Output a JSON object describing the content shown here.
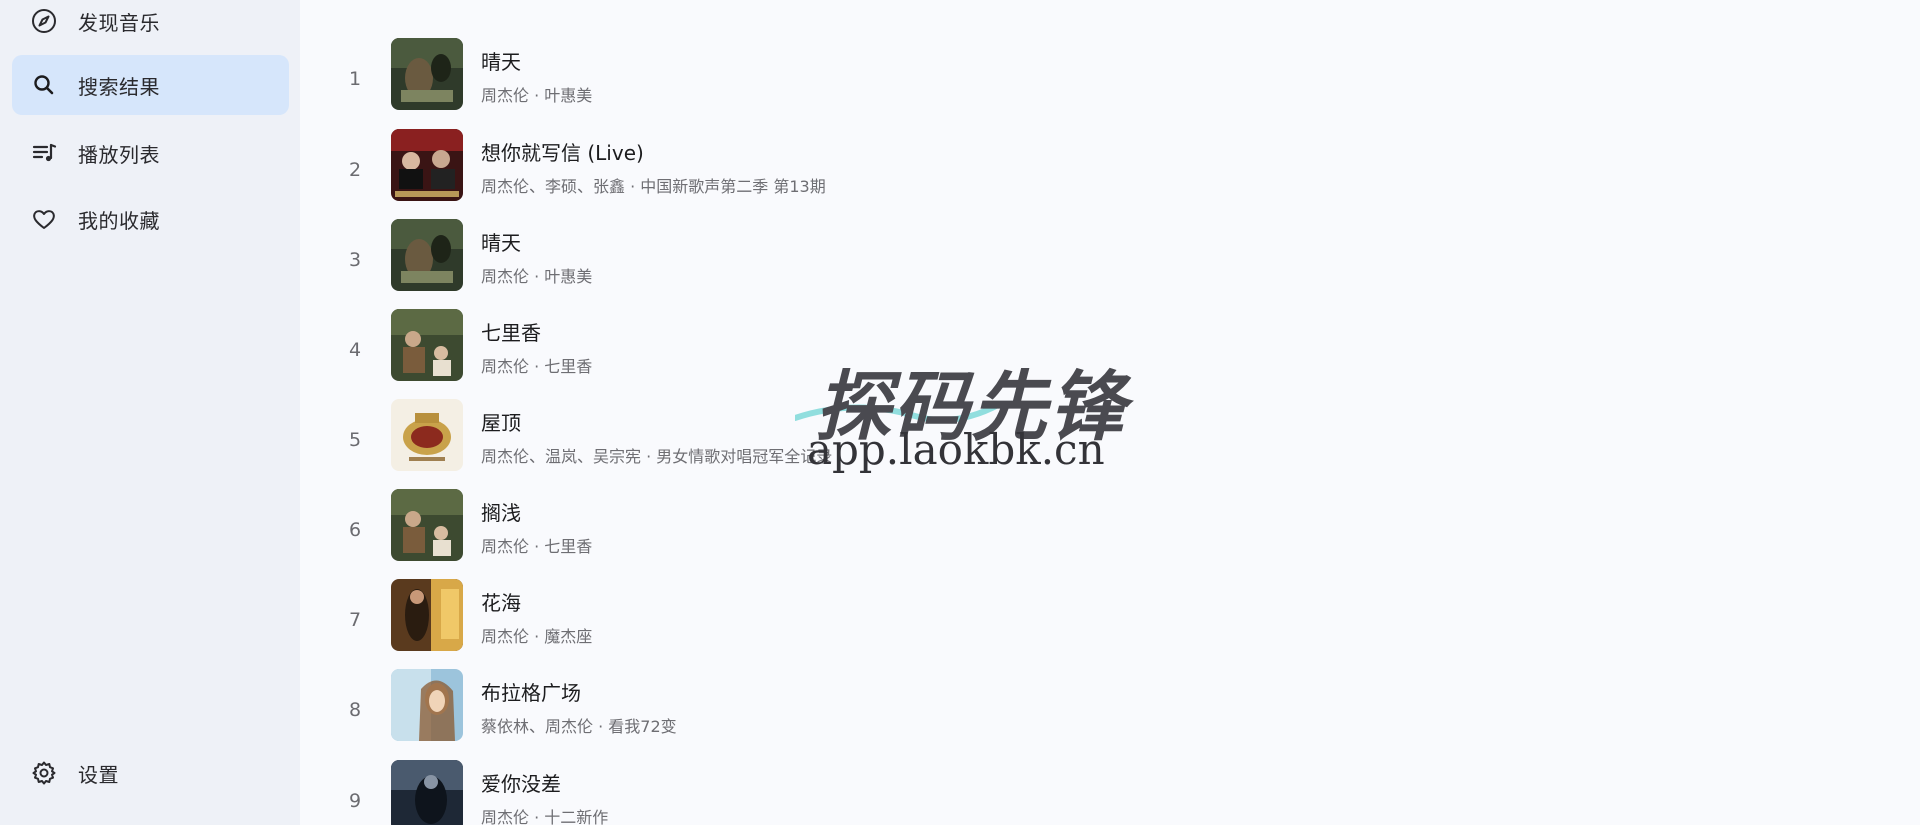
{
  "sidebar": {
    "items": [
      {
        "label": "发现音乐",
        "icon": "compass-icon",
        "active": false
      },
      {
        "label": "搜索结果",
        "icon": "search-icon",
        "active": true
      },
      {
        "label": "播放列表",
        "icon": "playlist-icon",
        "active": false
      },
      {
        "label": "我的收藏",
        "icon": "heart-icon",
        "active": false
      }
    ],
    "settings": {
      "label": "设置",
      "icon": "gear-icon"
    }
  },
  "songs": [
    {
      "index": "1",
      "title": "晴天",
      "subtitle": "周杰伦 · 叶惠美"
    },
    {
      "index": "2",
      "title": "想你就写信 (Live)",
      "subtitle": "周杰伦、李硕、张鑫 · 中国新歌声第二季 第13期"
    },
    {
      "index": "3",
      "title": "晴天",
      "subtitle": "周杰伦 · 叶惠美"
    },
    {
      "index": "4",
      "title": "七里香",
      "subtitle": "周杰伦 · 七里香"
    },
    {
      "index": "5",
      "title": "屋顶",
      "subtitle": "周杰伦、温岚、吴宗宪 · 男女情歌对唱冠军全记录"
    },
    {
      "index": "6",
      "title": "搁浅",
      "subtitle": "周杰伦 · 七里香"
    },
    {
      "index": "7",
      "title": "花海",
      "subtitle": "周杰伦 · 魔杰座"
    },
    {
      "index": "8",
      "title": "布拉格广场",
      "subtitle": "蔡依林、周杰伦 · 看我72变"
    },
    {
      "index": "9",
      "title": "爱你没差",
      "subtitle": "周杰伦 · 十二新作"
    }
  ],
  "watermark": {
    "title": "探码先锋",
    "url": "app.laokbk.cn"
  },
  "colors": {
    "sidebar_bg": "#eef1f7",
    "active_item_bg": "#d6e6fb",
    "main_bg": "#f9fafd"
  }
}
